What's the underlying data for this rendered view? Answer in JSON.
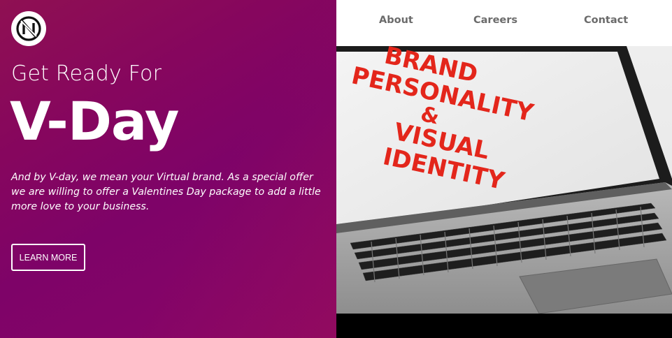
{
  "hero": {
    "kicker": "Get Ready For",
    "headline": "V-Day",
    "description": "And by V-day, we mean your Virtual brand. As a special offer we are willing to offer a Valentines Day package to add a little more love to your business.",
    "cta_label": "LEARN MORE",
    "logo_icon": "n-monogram-logo",
    "gradient_colors": [
      "#8f1052",
      "#7e0368"
    ]
  },
  "nav": {
    "items": [
      {
        "label": "About"
      },
      {
        "label": "Careers"
      },
      {
        "label": "Contact"
      }
    ],
    "text_color": "#6b6b6b"
  },
  "photo": {
    "screen_lines": [
      "BRAND",
      "PERSONALITY",
      "&",
      "VISUAL",
      "IDENTITY"
    ],
    "text_color": "#e3261b"
  }
}
